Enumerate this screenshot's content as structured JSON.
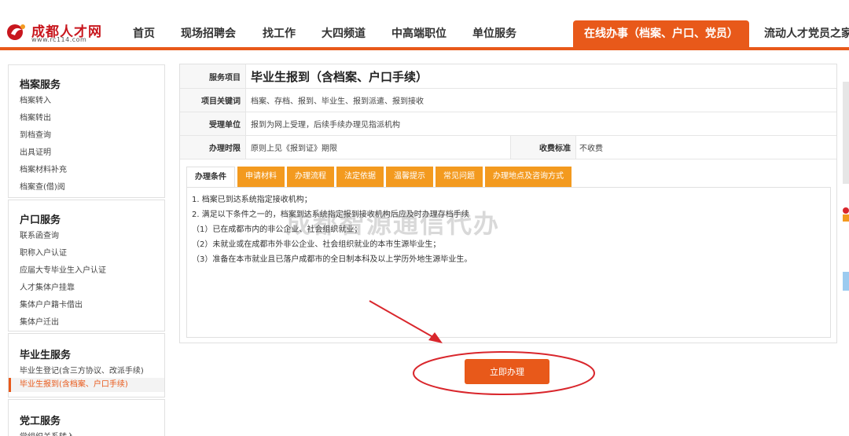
{
  "header": {
    "logo_name": "成都人才网",
    "logo_url": "www.rc114.com",
    "nav": [
      {
        "label": "首页"
      },
      {
        "label": "现场招聘会"
      },
      {
        "label": "找工作"
      },
      {
        "label": "大四频道"
      },
      {
        "label": "中高端职位"
      },
      {
        "label": "单位服务"
      },
      {
        "label": "在线办事（档案、户口、党员）",
        "active": true
      },
      {
        "label": "流动人才党员之家"
      }
    ]
  },
  "sidebar": {
    "sections": [
      {
        "title": "档案服务",
        "items": [
          "档案转入",
          "档案转出",
          "到档查询",
          "出具证明",
          "档案材料补充",
          "档案查(借)阅"
        ]
      },
      {
        "title": "户口服务",
        "items": [
          "联系函查询",
          "职称入户认证",
          "应届大专毕业生入户认证",
          "人才集体户挂靠",
          "集体户户籍卡借出",
          "集体户迁出"
        ]
      },
      {
        "title": "毕业生服务",
        "items": [
          "毕业生登记(含三方协议、改派手续)",
          "毕业生报到(含档案、户口手续)"
        ]
      },
      {
        "title": "党工服务",
        "items": [
          "党组织关系转入"
        ]
      }
    ]
  },
  "service": {
    "rows": [
      {
        "label": "服务项目",
        "value": "毕业生报到（含档案、户口手续）"
      },
      {
        "label": "项目关键词",
        "value": "档案、存档、报到、毕业生、报到派遣、报到接收"
      },
      {
        "label": "受理单位",
        "value": "报到为网上受理，后续手续办理见指派机构"
      },
      {
        "label": "办理时限",
        "value": "原则上见《报到证》期限"
      }
    ],
    "fee_label": "收费标准",
    "fee_value": "不收费"
  },
  "tabs": [
    "办理条件",
    "申请材料",
    "办理流程",
    "法定依据",
    "温馨提示",
    "常见问题",
    "办理地点及咨询方式"
  ],
  "content": [
    "1. 档案已到达系统指定接收机构；",
    "2. 满足以下条件之一的，档案到达系统指定报到接收机构后应及时办理存档手续",
    "（1）已在成都市内的非公企业、社会组织就业；",
    "（2）未就业或在成都市外非公企业、社会组织就业的本市生源毕业生；",
    "（3）准备在本市就业且已落户成都市的全日制本科及以上学历外地生源毕业生。"
  ],
  "watermark": "成都智源通信代办",
  "apply_button": "立即办理",
  "colors": {
    "accent": "#e8591a",
    "tab": "#f39a1f",
    "annotation": "#d9262c"
  }
}
